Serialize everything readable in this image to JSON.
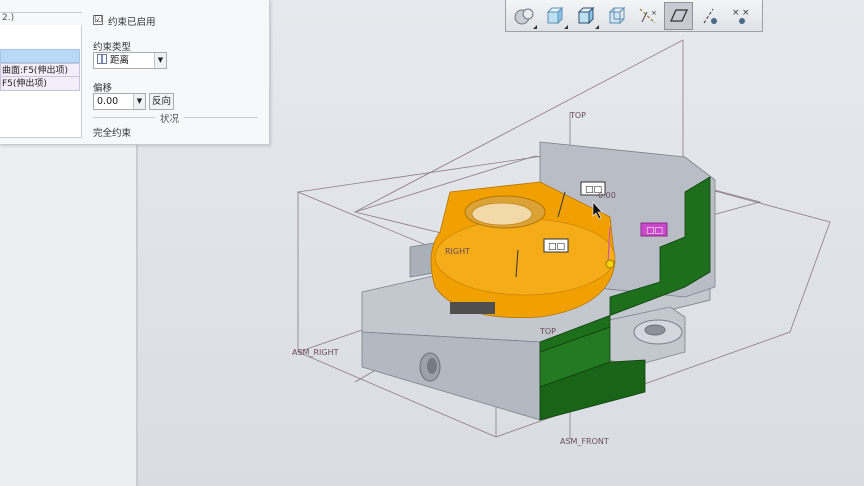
{
  "panel": {
    "ref_header": "2.)",
    "ref_items": [
      "",
      "曲面:F5(伸出项)",
      "F5(伸出项)"
    ],
    "enabled_label": "约束已启用",
    "enabled_checked": "☑",
    "constraint_type_label": "约束类型",
    "constraint_type_value": "距离",
    "offset_label": "偏移",
    "offset_value": "0.00",
    "flip_button": "反向",
    "status_section": "状况",
    "status_value": "完全约束"
  },
  "toolbar": {
    "buttons": [
      {
        "icon": "shaded-sphere-icon"
      },
      {
        "icon": "shaded-cube-icon"
      },
      {
        "icon": "shaded-edges-cube-icon"
      },
      {
        "icon": "wireframe-cube-icon"
      },
      {
        "icon": "datum-axis-icon"
      },
      {
        "icon": "datum-plane-icon",
        "active": true
      },
      {
        "icon": "datum-point-icon"
      },
      {
        "icon": "coordinate-system-icon"
      }
    ]
  },
  "viewport": {
    "datum_labels": {
      "top": "TOP",
      "right": "RIGHT",
      "asm_right": "ASM_RIGHT",
      "asm_front": "ASM_FRONT",
      "top2": "TOP",
      "value": "0.00"
    },
    "tags": [
      "□□",
      "□□",
      "□□"
    ],
    "colors": {
      "orange_part": "#f0a000",
      "green_face": "#1e6f1c",
      "grey_part": "#b8bec6",
      "highlight_tag": "#c94ac9"
    }
  }
}
